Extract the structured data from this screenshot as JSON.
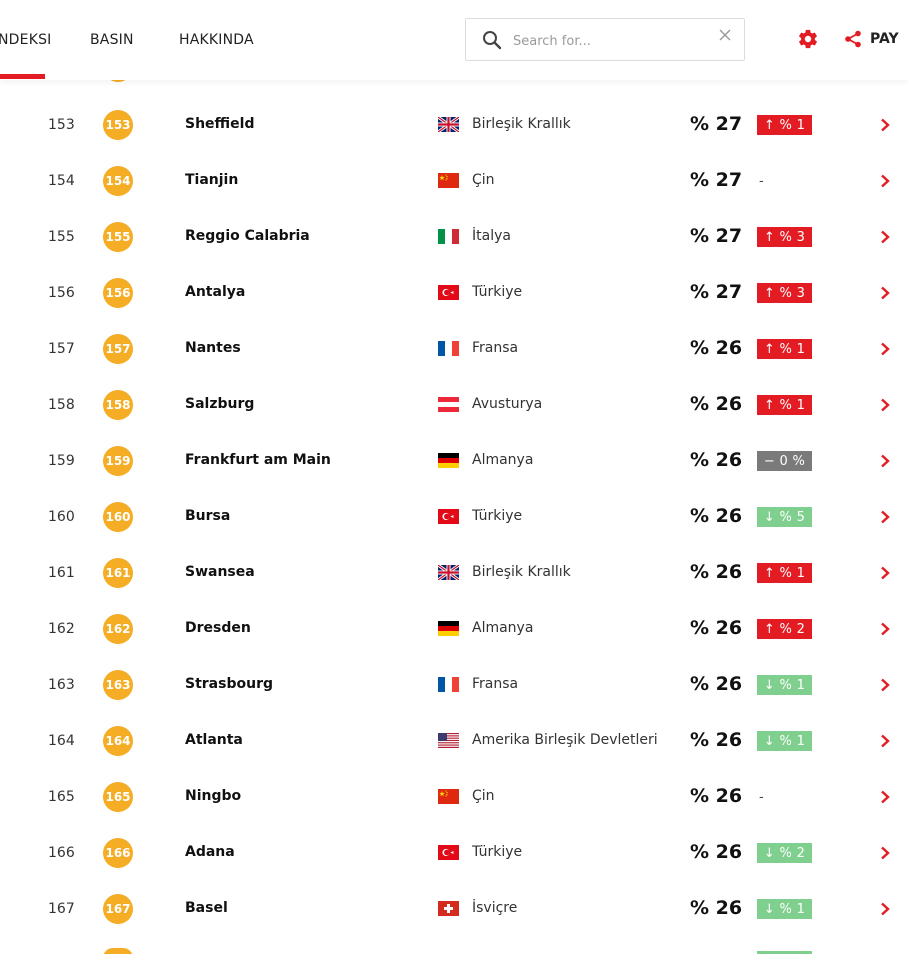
{
  "nav": {
    "items": [
      {
        "label": "NDEKSI"
      },
      {
        "label": "BASIN"
      },
      {
        "label": "HAKKINDA"
      }
    ]
  },
  "search": {
    "placeholder": "Search for..."
  },
  "share": {
    "label": "PAY"
  },
  "colors": {
    "accent": "#e31b23",
    "badge": "#f4ad25",
    "down": "#7fcf8f",
    "neutral": "#7a7a7a"
  },
  "rows": [
    {
      "rank": "153",
      "badge": "153",
      "city": "Sheffield",
      "flag": "uk",
      "country": "Birleşik Krallık",
      "score": "% 27",
      "change": "↑ % 1",
      "trend": "up"
    },
    {
      "rank": "154",
      "badge": "154",
      "city": "Tianjin",
      "flag": "cn",
      "country": "Çin",
      "score": "% 27",
      "change": "-",
      "trend": "none"
    },
    {
      "rank": "155",
      "badge": "155",
      "city": "Reggio Calabria",
      "flag": "it",
      "country": "İtalya",
      "score": "% 27",
      "change": "↑ % 3",
      "trend": "up"
    },
    {
      "rank": "156",
      "badge": "156",
      "city": "Antalya",
      "flag": "tr",
      "country": "Türkiye",
      "score": "% 27",
      "change": "↑ % 3",
      "trend": "up"
    },
    {
      "rank": "157",
      "badge": "157",
      "city": "Nantes",
      "flag": "fr",
      "country": "Fransa",
      "score": "% 26",
      "change": "↑ % 1",
      "trend": "up"
    },
    {
      "rank": "158",
      "badge": "158",
      "city": "Salzburg",
      "flag": "at",
      "country": "Avusturya",
      "score": "% 26",
      "change": "↑ % 1",
      "trend": "up"
    },
    {
      "rank": "159",
      "badge": "159",
      "city": "Frankfurt am Main",
      "flag": "de",
      "country": "Almanya",
      "score": "% 26",
      "change": "− 0 %",
      "trend": "neutral"
    },
    {
      "rank": "160",
      "badge": "160",
      "city": "Bursa",
      "flag": "tr",
      "country": "Türkiye",
      "score": "% 26",
      "change": "↓ % 5",
      "trend": "down"
    },
    {
      "rank": "161",
      "badge": "161",
      "city": "Swansea",
      "flag": "uk",
      "country": "Birleşik Krallık",
      "score": "% 26",
      "change": "↑ % 1",
      "trend": "up"
    },
    {
      "rank": "162",
      "badge": "162",
      "city": "Dresden",
      "flag": "de",
      "country": "Almanya",
      "score": "% 26",
      "change": "↑ % 2",
      "trend": "up"
    },
    {
      "rank": "163",
      "badge": "163",
      "city": "Strasbourg",
      "flag": "fr",
      "country": "Fransa",
      "score": "% 26",
      "change": "↓ % 1",
      "trend": "down"
    },
    {
      "rank": "164",
      "badge": "164",
      "city": "Atlanta",
      "flag": "us",
      "country": "Amerika Birleşik Devletleri",
      "score": "% 26",
      "change": "↓ % 1",
      "trend": "down"
    },
    {
      "rank": "165",
      "badge": "165",
      "city": "Ningbo",
      "flag": "cn",
      "country": "Çin",
      "score": "% 26",
      "change": "-",
      "trend": "none"
    },
    {
      "rank": "166",
      "badge": "166",
      "city": "Adana",
      "flag": "tr",
      "country": "Türkiye",
      "score": "% 26",
      "change": "↓ % 2",
      "trend": "down"
    },
    {
      "rank": "167",
      "badge": "167",
      "city": "Basel",
      "flag": "ch",
      "country": "İsviçre",
      "score": "% 26",
      "change": "↓ % 1",
      "trend": "down"
    }
  ]
}
